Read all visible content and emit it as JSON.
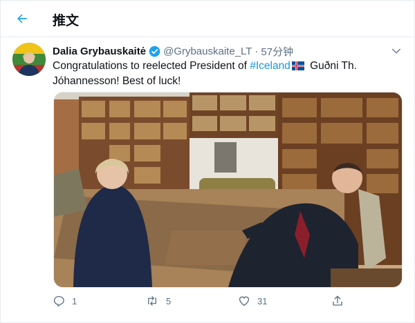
{
  "header": {
    "title": "推文",
    "back_icon": "arrow-left-icon"
  },
  "tweet": {
    "author_name": "Dalia Grybauskaitė",
    "handle": "@Grybauskaite_LT",
    "separator": "·",
    "time": "57分钟",
    "text_part1": "Congratulations to reelected President of ",
    "hashtag": "#Iceland",
    "text_part2": " Guðni Th. Jóhannesson! Best of luck!",
    "flag_icon": "iceland-flag-icon"
  },
  "actions": {
    "reply_count": "1",
    "retweet_count": "5",
    "like_count": "31"
  },
  "colors": {
    "accent": "#1da1f2",
    "hashtag": "#1b95e0",
    "muted": "#5b7083"
  }
}
